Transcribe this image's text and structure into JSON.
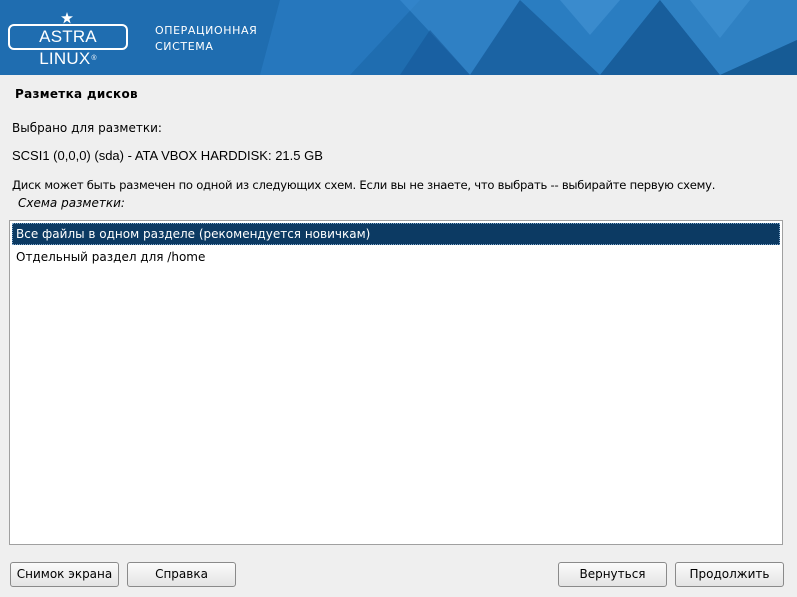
{
  "header": {
    "logo_text": "ASTRA LINUX",
    "logo_reg": "®",
    "caption_line1": "ОПЕРАЦИОННАЯ",
    "caption_line2": "СИСТЕМА",
    "colors": {
      "banner": "#1f6db0",
      "banner_light": "#3b8fd1",
      "banner_dark": "#14568f"
    }
  },
  "page": {
    "title": "Разметка дисков",
    "selected_for_label": "Выбрано для разметки:",
    "disk": "SCSI1 (0,0,0) (sda) - ATA VBOX HARDDISK: 21.5 GB",
    "description": "Диск может быть размечен по одной из следующих схем. Если вы не знаете, что выбрать -- выбирайте первую схему.",
    "scheme_label": "Схема разметки:"
  },
  "schemes": {
    "items": [
      {
        "label": "Все файлы в одном разделе (рекомендуется новичкам)",
        "selected": true
      },
      {
        "label": "Отдельный раздел для /home",
        "selected": false
      }
    ],
    "colors": {
      "selected_bg": "#0c3a63",
      "selected_fg": "#ffffff"
    }
  },
  "buttons": {
    "screenshot": "Снимок экрана",
    "help": "Справка",
    "back": "Вернуться",
    "continue": "Продолжить"
  }
}
